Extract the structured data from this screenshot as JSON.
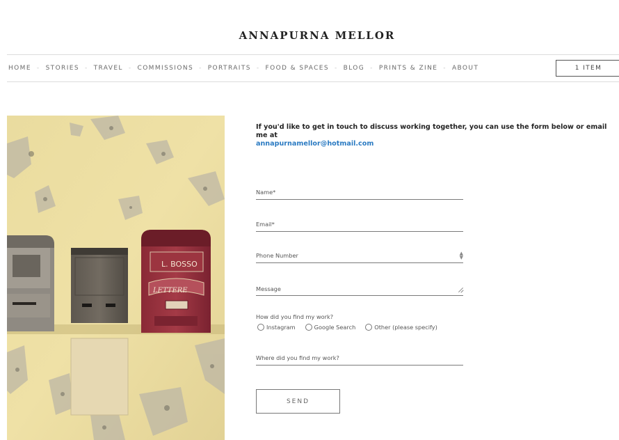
{
  "site": {
    "title": "ANNAPURNA MELLOR"
  },
  "nav": {
    "items": [
      "HOME",
      "STORIES",
      "TRAVEL",
      "COMMISSIONS",
      "PORTRAITS",
      "FOOD & SPACES",
      "BLOG",
      "PRINTS & ZINE",
      "ABOUT"
    ],
    "separator": "-",
    "cart_label": "1 ITEM"
  },
  "photo": {
    "mailbox_text": "L. BOSSO",
    "mailbox_sign": "LETTERE"
  },
  "contact": {
    "intro": "If you'd like to get in touch to discuss working together, you can use the form below or email me at",
    "email": "annapurnamellor@hotmail.com",
    "fields": {
      "name": "Name*",
      "email": "Email*",
      "phone": "Phone Number",
      "message": "Message",
      "where": "Where did you find my work?"
    },
    "question": "How did you find my work?",
    "options": [
      "Instagram",
      "Google Search",
      "Other (please specify)"
    ],
    "send_label": "SEND"
  },
  "colors": {
    "link": "#2a7ac2",
    "wall": "#e9dba0"
  }
}
